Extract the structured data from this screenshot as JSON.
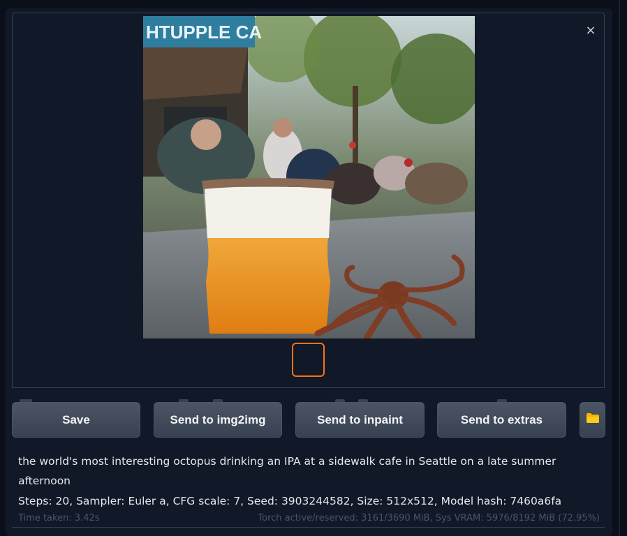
{
  "gallery": {
    "close_label": "×",
    "image_alt": "the world's most interesting octopus drinking an IPA at a sidewalk cafe in Seattle on a late summer afternoon",
    "awning_text": "HTUPPLE CA"
  },
  "actions": {
    "save_label": "Save",
    "img2img_label": "Send to img2img",
    "inpaint_label": "Send to inpaint",
    "extras_label": "Send to extras",
    "folder_icon": "folder-icon"
  },
  "generation_info": {
    "prompt": "the world's most interesting octopus drinking an IPA at a sidewalk cafe in Seattle on a late summer afternoon",
    "params": "Steps: 20, Sampler: Euler a, CFG scale: 7, Seed: 3903244582, Size: 512x512, Model hash: 7460a6fa"
  },
  "footer": {
    "time_taken": "Time taken: 3.42s",
    "memory": "Torch active/reserved: 3161/3690 MiB, Sys VRAM: 5976/8192 MiB (72.95%)"
  },
  "colors": {
    "background": "#0b0f19",
    "panel": "#111827",
    "button": "#374151",
    "thumb_border": "#f97316"
  }
}
